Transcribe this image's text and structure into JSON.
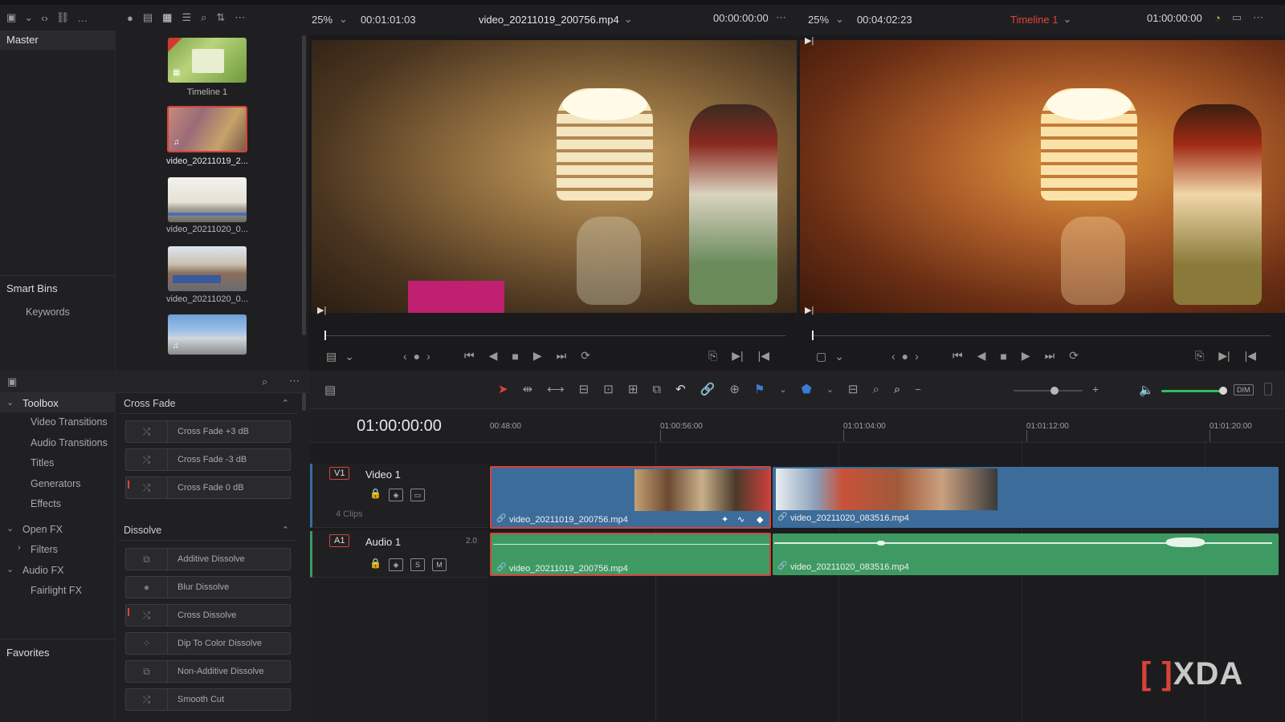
{
  "top_bar": {
    "left_viewer": {
      "zoom": "25%",
      "timecode": "00:01:01:03",
      "clip_name": "video_20211019_200756.mp4",
      "position": "00:00:00:00"
    },
    "right_viewer": {
      "zoom": "25%",
      "timecode": "00:04:02:23",
      "timeline_name": "Timeline 1",
      "position": "01:00:00:00"
    }
  },
  "bins": {
    "master": "Master",
    "smart_bins": "Smart Bins",
    "keywords": "Keywords"
  },
  "media_pool": {
    "items": [
      {
        "label": "Timeline 1"
      },
      {
        "label": "video_20211019_2..."
      },
      {
        "label": "video_20211020_0..."
      },
      {
        "label": "video_20211020_0..."
      },
      {
        "label": ""
      }
    ]
  },
  "effects": {
    "toolbox": "Toolbox",
    "sidebar": [
      "Video Transitions",
      "Audio Transitions",
      "Titles",
      "Generators",
      "Effects"
    ],
    "open_fx": "Open FX",
    "filters": "Filters",
    "audio_fx": "Audio FX",
    "fairlight_fx": "Fairlight FX",
    "favorites": "Favorites",
    "cross_fade": {
      "title": "Cross Fade",
      "items": [
        "Cross Fade +3 dB",
        "Cross Fade -3 dB",
        "Cross Fade 0 dB"
      ]
    },
    "dissolve": {
      "title": "Dissolve",
      "items": [
        "Additive Dissolve",
        "Blur Dissolve",
        "Cross Dissolve",
        "Dip To Color Dissolve",
        "Non-Additive Dissolve",
        "Smooth Cut"
      ]
    }
  },
  "timeline": {
    "timecode": "01:00:00:00",
    "ruler": [
      "00:48:00",
      "01:00:56:00",
      "01:01:04:00",
      "01:01:12:00",
      "01:01:20:00"
    ],
    "video_track": {
      "id": "V1",
      "name": "Video 1",
      "clip_count": "4 Clips"
    },
    "audio_track": {
      "id": "A1",
      "name": "Audio 1",
      "channels": "2.0",
      "solo": "S",
      "mute": "M"
    },
    "clips": {
      "video_1": "video_20211019_200756.mp4",
      "video_2": "video_20211020_083516.mp4",
      "audio_1": "video_20211019_200756.mp4",
      "audio_2": "video_20211020_083516.mp4"
    },
    "dim_label": "DIM"
  },
  "watermark": "XDA",
  "colors": {
    "accent_red": "#e0443a",
    "video_clip": "#3c6c9a",
    "audio_clip": "#3e9a62",
    "selection": "#d8423a"
  }
}
